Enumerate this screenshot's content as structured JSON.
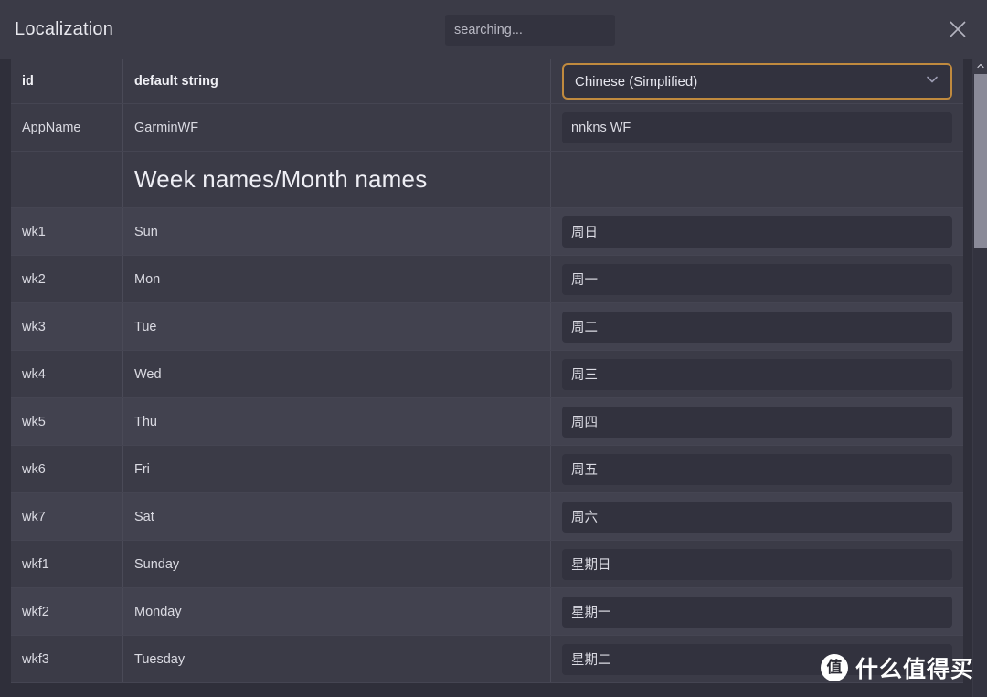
{
  "window": {
    "title": "Localization",
    "close_icon": "close-icon"
  },
  "search": {
    "placeholder": "searching...",
    "value": "",
    "icon": "search-icon"
  },
  "table": {
    "headers": {
      "id": "id",
      "default_string": "default string"
    },
    "language_select": {
      "value": "Chinese (Simplified)",
      "chevron_icon": "chevron-down-icon",
      "border_color": "#c08a3e"
    },
    "rows": [
      {
        "kind": "data",
        "id": "AppName",
        "default": "GarminWF",
        "translation": "nnkns WF"
      },
      {
        "kind": "section",
        "id": "",
        "default": "Week names/Month names",
        "translation": ""
      },
      {
        "kind": "data",
        "id": "wk1",
        "default": "Sun",
        "translation": "周日"
      },
      {
        "kind": "data",
        "id": "wk2",
        "default": "Mon",
        "translation": "周一"
      },
      {
        "kind": "data",
        "id": "wk3",
        "default": "Tue",
        "translation": "周二"
      },
      {
        "kind": "data",
        "id": "wk4",
        "default": "Wed",
        "translation": "周三"
      },
      {
        "kind": "data",
        "id": "wk5",
        "default": "Thu",
        "translation": "周四"
      },
      {
        "kind": "data",
        "id": "wk6",
        "default": "Fri",
        "translation": "周五"
      },
      {
        "kind": "data",
        "id": "wk7",
        "default": "Sat",
        "translation": "周六"
      },
      {
        "kind": "data",
        "id": "wkf1",
        "default": "Sunday",
        "translation": "星期日"
      },
      {
        "kind": "data",
        "id": "wkf2",
        "default": "Monday",
        "translation": "星期一"
      },
      {
        "kind": "data",
        "id": "wkf3",
        "default": "Tuesday",
        "translation": "星期二"
      }
    ]
  },
  "scrollbar": {
    "up_arrow_icon": "chevron-up-icon",
    "orientation": "vertical"
  },
  "watermark": {
    "badge": "值",
    "text": "什么值得买"
  },
  "colors": {
    "page_background": "#2f2f3a",
    "panel": "#3b3b47",
    "row_alt": "#42424f",
    "input": "#32323e",
    "accent": "#c08a3e",
    "text": "#dadae2"
  }
}
